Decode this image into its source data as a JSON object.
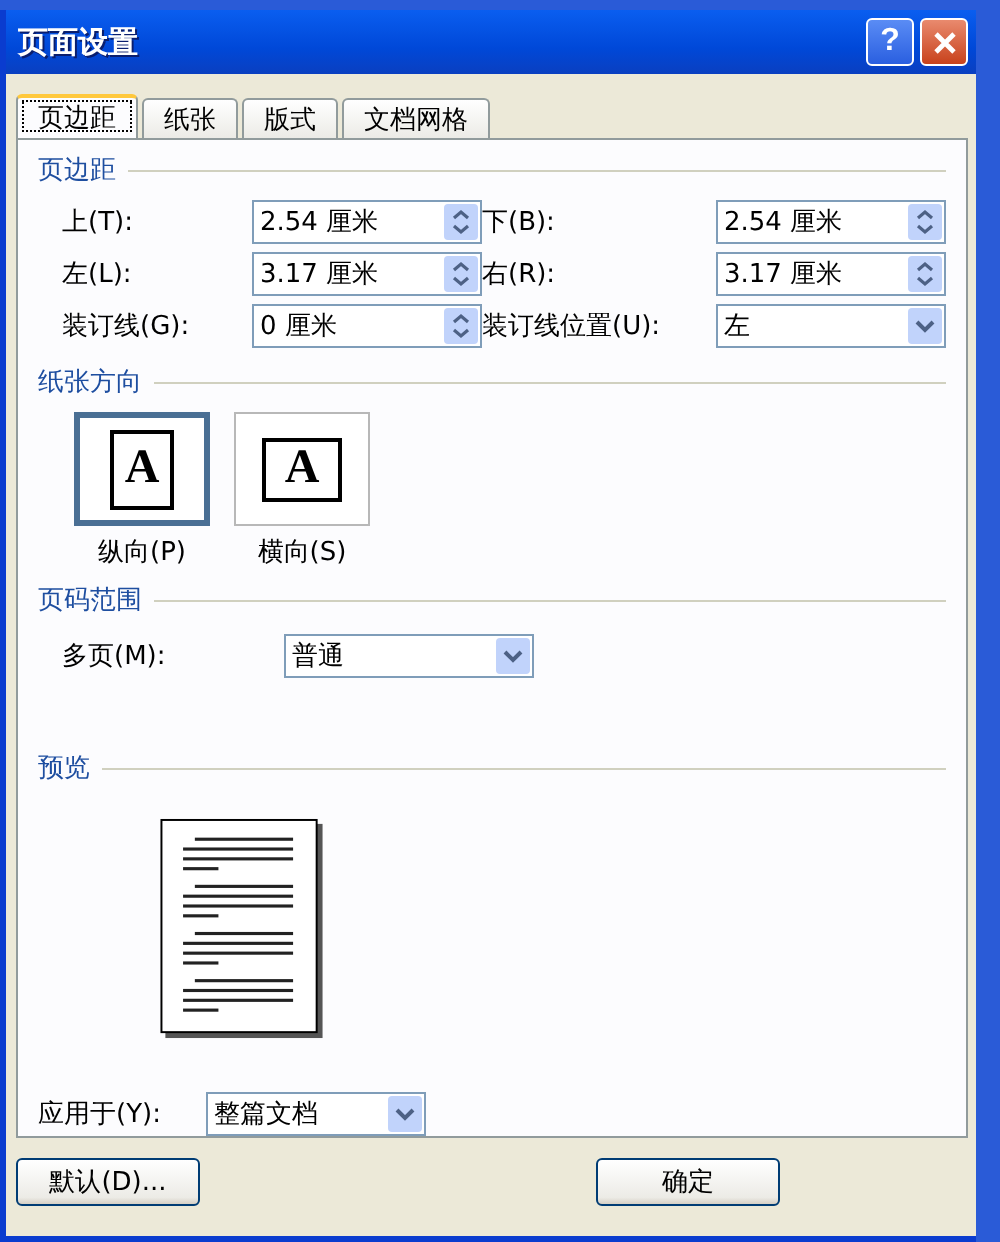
{
  "window": {
    "title": "页面设置",
    "buttons": [
      {
        "kind": "help",
        "label": "?"
      },
      {
        "kind": "close"
      }
    ]
  },
  "tabs": [
    {
      "label": "页边距",
      "selected": true
    },
    {
      "label": "纸张",
      "selected": false
    },
    {
      "label": "版式",
      "selected": false
    },
    {
      "label": "文档网格",
      "selected": false
    }
  ],
  "margins": {
    "title": "页边距",
    "fields": [
      {
        "label": "上(T):",
        "value": "2.54 厘米",
        "kind": "spin"
      },
      {
        "label": "下(B):",
        "value": "2.54 厘米",
        "kind": "spin"
      },
      {
        "label": "左(L):",
        "value": "3.17 厘米",
        "kind": "spin"
      },
      {
        "label": "右(R):",
        "value": "3.17 厘米",
        "kind": "spin"
      },
      {
        "label": "装订线(G):",
        "value": "0 厘米",
        "kind": "spin"
      },
      {
        "label": "装订线位置(U):",
        "value": "左",
        "kind": "dropdown"
      }
    ]
  },
  "orientation": {
    "title": "纸张方向",
    "options": [
      {
        "label": "纵向(P)",
        "glyph": "A",
        "kind": "portrait",
        "selected": true
      },
      {
        "label": "横向(S)",
        "glyph": "A",
        "kind": "landscape",
        "selected": false
      }
    ]
  },
  "page_range": {
    "title": "页码范围",
    "label": "多页(M):",
    "value": "普通"
  },
  "preview": {
    "title": "预览"
  },
  "apply_to": {
    "label": "应用于(Y):",
    "value": "整篇文档"
  },
  "buttons": [
    {
      "label": "默认(D)..."
    },
    {
      "label": "确定"
    }
  ]
}
